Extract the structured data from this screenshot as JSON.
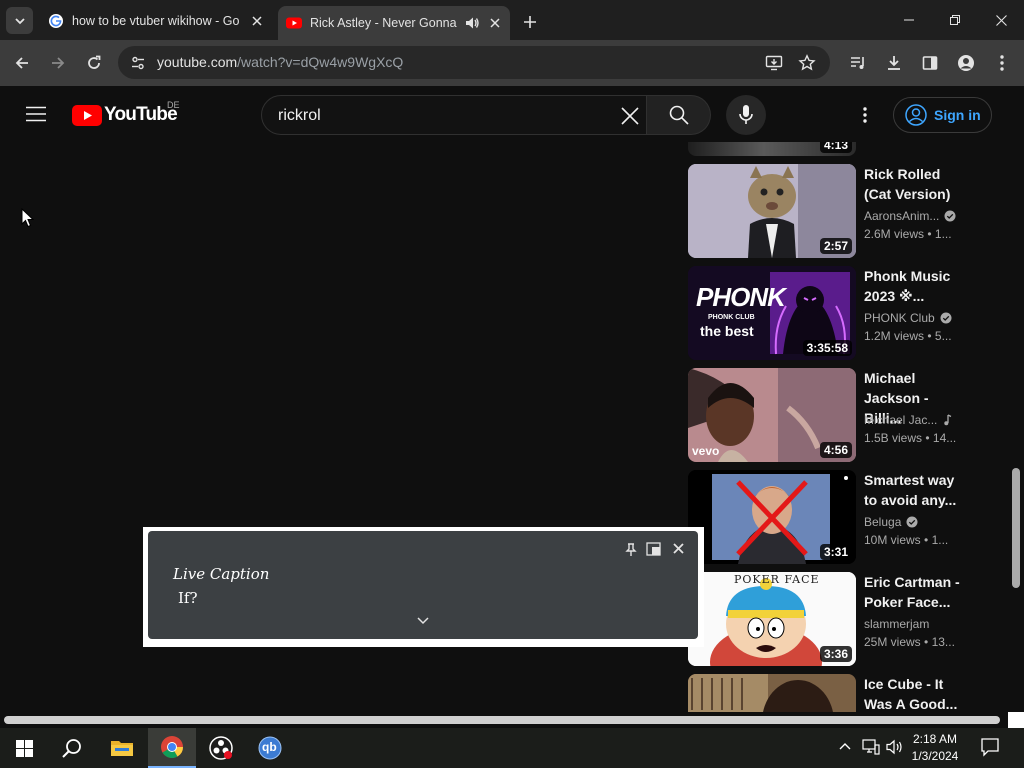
{
  "browser": {
    "tabs": [
      {
        "title": "how to be vtuber wikihow - Go",
        "favicon": "google-icon",
        "active": false
      },
      {
        "title": "Rick Astley - Never Gonna G",
        "favicon": "youtube-icon",
        "active": true,
        "audio": true
      }
    ],
    "url_host": "youtube.com",
    "url_path": "/watch?v=dQw4w9WgXcQ"
  },
  "youtube": {
    "logo_text": "YouTube",
    "country_code": "DE",
    "search_value": "rickrol",
    "sign_in_label": "Sign in"
  },
  "recommendations": [
    {
      "title": "Rick Rolled (Cat Version)",
      "channel": "AaronsAnim...",
      "verified": true,
      "views": "2.6M views",
      "age": "1...",
      "duration": "2:57"
    },
    {
      "title": "Phonk Music 2023 ※...",
      "channel": "PHONK Club",
      "verified": true,
      "views": "1.2M views",
      "age": "5...",
      "duration": "3:35:58",
      "thumb_text_1": "PHONK",
      "thumb_text_2": "PHONK CLUB",
      "thumb_text_3": "the best"
    },
    {
      "title": "Michael Jackson - Billi...",
      "channel": "Michael Jac...",
      "music": true,
      "views": "1.5B views",
      "age": "14...",
      "duration": "4:56",
      "thumb_text_1": "vevo"
    },
    {
      "title": "Smartest way to avoid any...",
      "channel": "Beluga",
      "verified": true,
      "views": "10M views",
      "age": "1...",
      "duration": "3:31"
    },
    {
      "title": "Eric Cartman - Poker Face...",
      "channel": "slammerjam",
      "verified": false,
      "views": "25M views",
      "age": "13...",
      "duration": "3:36",
      "thumb_text_1": "POKER FACE"
    },
    {
      "title": "Ice Cube - It Was A Good...",
      "channel": "",
      "views": "",
      "age": "",
      "duration": ""
    }
  ],
  "top_partial_duration": "4:13",
  "live_caption": {
    "label": "Live Caption",
    "text": "If?"
  },
  "taskbar": {
    "time": "2:18 AM",
    "date": "1/3/2024",
    "qb_label": "qb"
  },
  "colors": {
    "youtube_red": "#ff0000",
    "link_blue": "#3ea6ff",
    "page_bg": "#0f0f0f"
  }
}
